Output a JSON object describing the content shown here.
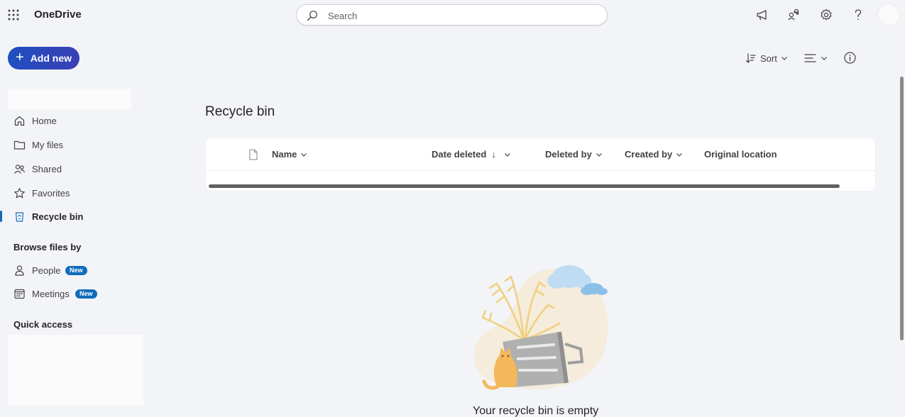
{
  "app": {
    "name": "OneDrive"
  },
  "search": {
    "placeholder": "Search"
  },
  "actions": {
    "add_new_label": "Add new"
  },
  "toolbar": {
    "sort_label": "Sort"
  },
  "sidebar": {
    "items": [
      {
        "label": "Home",
        "icon": "home-icon"
      },
      {
        "label": "My files",
        "icon": "folder-icon"
      },
      {
        "label": "Shared",
        "icon": "people-icon"
      },
      {
        "label": "Favorites",
        "icon": "star-icon"
      },
      {
        "label": "Recycle bin",
        "icon": "recycle-bin-icon",
        "active": true
      }
    ],
    "browse_title": "Browse files by",
    "browse_items": [
      {
        "label": "People",
        "icon": "person-icon",
        "badge": "New"
      },
      {
        "label": "Meetings",
        "icon": "calendar-icon",
        "badge": "New"
      }
    ],
    "quick_access_title": "Quick access"
  },
  "main": {
    "title": "Recycle bin",
    "columns": [
      {
        "label": "Name",
        "sort": ""
      },
      {
        "label": "Date deleted",
        "sort": "↓"
      },
      {
        "label": "Deleted by",
        "sort": ""
      },
      {
        "label": "Created by",
        "sort": ""
      },
      {
        "label": "Original location",
        "sort": ""
      }
    ],
    "empty_message": "Your recycle bin is empty"
  },
  "colors": {
    "accent": "#0f6cbd",
    "add_new_gradient_start": "#1f4fc1",
    "add_new_gradient_end": "#3a3fb4"
  }
}
